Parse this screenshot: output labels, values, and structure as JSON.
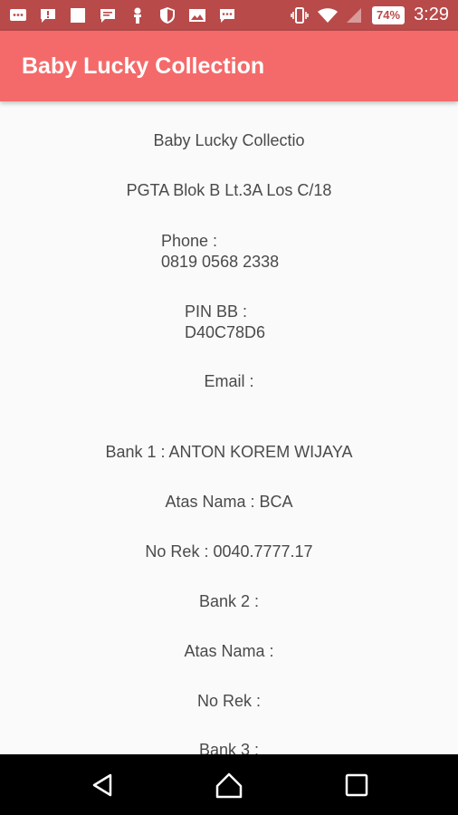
{
  "status_bar": {
    "battery": "74%",
    "time": "3:29",
    "left_icons": [
      "message-icon",
      "alert-icon",
      "square-icon",
      "chat-icon",
      "person-icon",
      "shield-icon",
      "image-icon",
      "chat-icon"
    ],
    "right_icons": [
      "vibrate-icon",
      "wifi-icon",
      "signal-icon"
    ]
  },
  "app_bar": {
    "title": "Baby Lucky Collection"
  },
  "store": {
    "name": "Baby Lucky Collectio",
    "address": "PGTA Blok B Lt.3A Los C/18",
    "phone_label": "Phone :",
    "phone_value": "0819 0568 2338",
    "pin_label": "PIN BB :",
    "pin_value": "D40C78D6",
    "email": "Email :",
    "bank1": "Bank 1 : ANTON KOREM WIJAYA",
    "name1": "Atas Nama : BCA",
    "rek1": "No Rek : 0040.7777.17",
    "bank2": "Bank 2 :",
    "name2": "Atas Nama :",
    "rek2": "No Rek :",
    "bank3": "Bank 3 :"
  },
  "nav_bar": {
    "buttons": [
      "back-icon",
      "home-icon",
      "recents-icon"
    ]
  },
  "colors": {
    "status_bar": "#b94a4a",
    "app_bar": "#f46a6a",
    "text": "#4a4a4a",
    "nav_bar": "#000000"
  }
}
